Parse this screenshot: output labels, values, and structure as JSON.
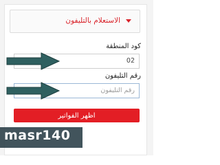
{
  "accordion": {
    "title": "الاستعلام بالتليفون",
    "icon": "caret-down-icon"
  },
  "area_code": {
    "label": "كود المنطقة",
    "value": "02"
  },
  "phone": {
    "label": "رقم التليفون",
    "placeholder": "رقم التليفون"
  },
  "submit": {
    "label": "اظهر الفواتير"
  },
  "watermark": {
    "text": "masr140"
  },
  "annotations": {
    "arrow_icon": "right-arrow-icon",
    "arrow_color": "#2f6060"
  },
  "colors": {
    "accent": "#e31e25"
  }
}
